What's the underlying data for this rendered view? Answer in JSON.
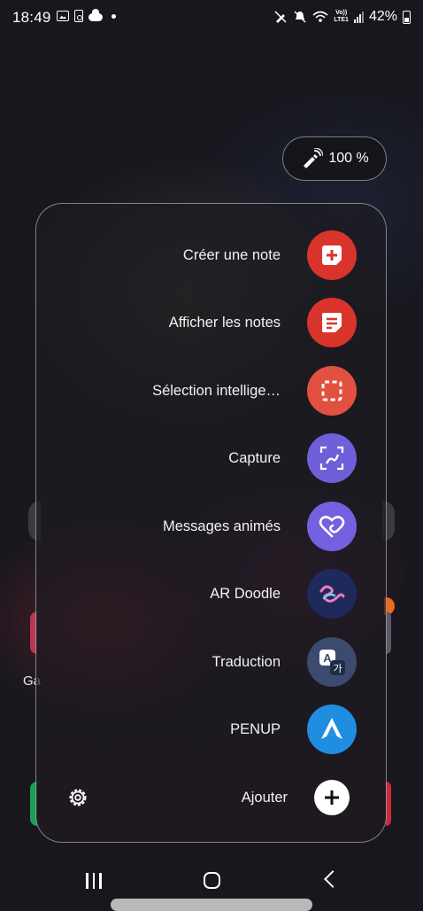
{
  "status_bar": {
    "time": "18:49",
    "signal_label": "Vo))\nLTE1",
    "battery": "42%"
  },
  "pen_pill": {
    "label": "100 %"
  },
  "menu": {
    "items": [
      {
        "label": "Créer une note",
        "color": "#d9342b",
        "icon": "create-note-icon"
      },
      {
        "label": "Afficher les notes",
        "color": "#d9342b",
        "icon": "view-notes-icon"
      },
      {
        "label": "Sélection intellige…",
        "color": "#e2513f",
        "icon": "smart-select-icon"
      },
      {
        "label": "Capture",
        "color": "#6f5fd8",
        "icon": "screen-write-icon"
      },
      {
        "label": "Messages animés",
        "color": "#7461e0",
        "icon": "live-message-icon"
      },
      {
        "label": "AR Doodle",
        "color": "#1f2a5c",
        "icon": "ar-doodle-icon"
      },
      {
        "label": "Traduction",
        "color": "#3b4a6e",
        "icon": "translate-icon"
      },
      {
        "label": "PENUP",
        "color": "#1f8ee0",
        "icon": "penup-icon"
      },
      {
        "label": "Ajouter",
        "color": "#ffffff",
        "icon": "add-icon"
      }
    ]
  },
  "background": {
    "partial_label": "Ga"
  }
}
